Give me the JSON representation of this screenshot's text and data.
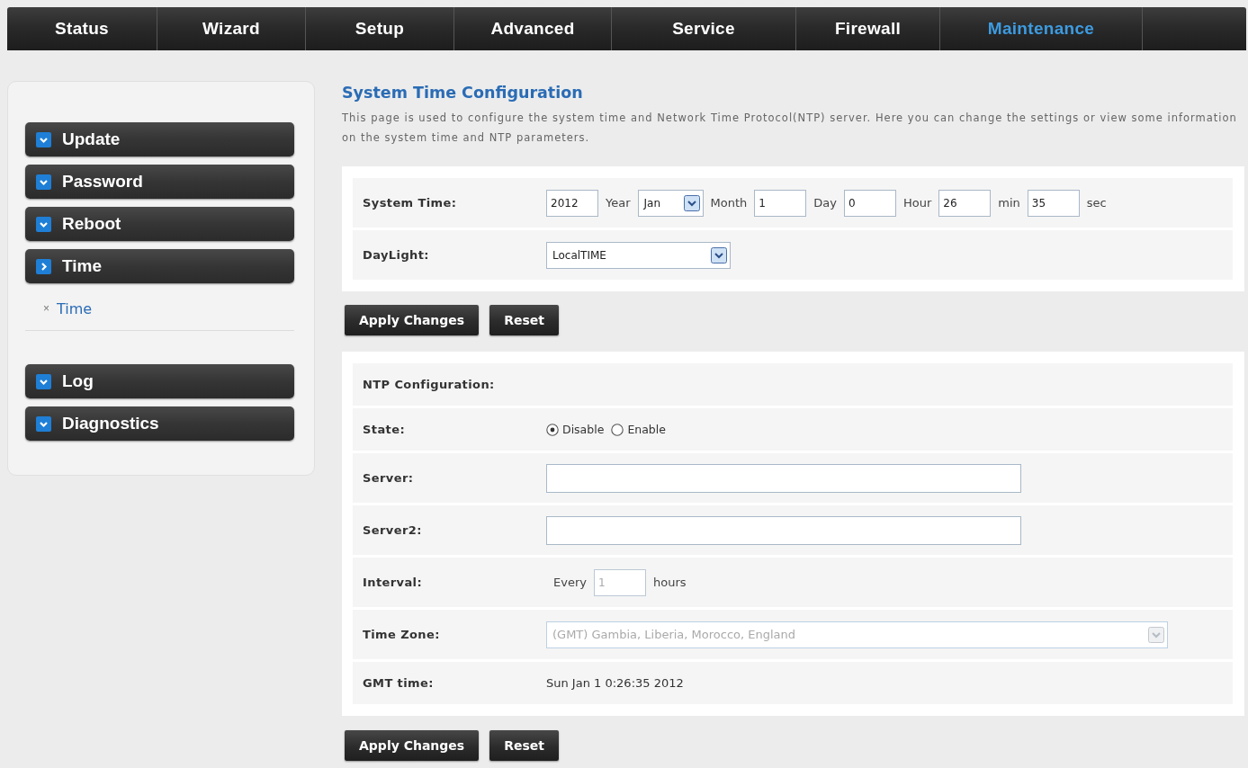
{
  "nav": {
    "tabs": [
      {
        "label": "Status",
        "selected": false
      },
      {
        "label": "Wizard",
        "selected": false
      },
      {
        "label": "Setup",
        "selected": false
      },
      {
        "label": "Advanced",
        "selected": false
      },
      {
        "label": "Service",
        "selected": false
      },
      {
        "label": "Firewall",
        "selected": false
      },
      {
        "label": "Maintenance",
        "selected": true
      }
    ]
  },
  "sidebar": {
    "sections": [
      {
        "items": [
          {
            "label": "Update",
            "expanded": false
          },
          {
            "label": "Password",
            "expanded": false
          },
          {
            "label": "Reboot",
            "expanded": false
          },
          {
            "label": "Time",
            "expanded": true,
            "children": [
              {
                "marker": "×",
                "label": "Time"
              }
            ]
          }
        ]
      },
      {
        "items": [
          {
            "label": "Log",
            "expanded": false
          },
          {
            "label": "Diagnostics",
            "expanded": false
          }
        ]
      }
    ]
  },
  "page": {
    "title": "System Time Configuration",
    "description": "This page is used to configure the system time and Network Time Protocol(NTP) server. Here you can change the settings or view some information on the system time and NTP parameters."
  },
  "forms": [
    {
      "rows": [
        {
          "kind": "inline",
          "label": "System Time:",
          "parts": [
            {
              "kind": "input",
              "value": "2012",
              "disabled": false
            },
            {
              "kind": "text",
              "text": "Year"
            },
            {
              "kind": "select",
              "value": "Jan",
              "disabled": false
            },
            {
              "kind": "text",
              "text": "Month"
            },
            {
              "kind": "input",
              "value": "1",
              "disabled": false
            },
            {
              "kind": "text",
              "text": "Day"
            },
            {
              "kind": "input",
              "value": "0",
              "disabled": false
            },
            {
              "kind": "text",
              "text": "Hour"
            },
            {
              "kind": "input",
              "value": "26",
              "disabled": false
            },
            {
              "kind": "text",
              "text": "min"
            },
            {
              "kind": "input",
              "value": "35",
              "disabled": false
            },
            {
              "kind": "text",
              "text": "sec"
            }
          ]
        },
        {
          "kind": "select",
          "label": "DayLight:",
          "value": "LocalTIME",
          "disabled": false
        }
      ],
      "buttons": [
        "Apply Changes",
        "Reset"
      ]
    },
    {
      "rows": [
        {
          "kind": "heading",
          "label": "NTP Configuration:"
        },
        {
          "kind": "radios",
          "label": "State:",
          "options": [
            {
              "label": "Disable",
              "selected": true
            },
            {
              "label": "Enable",
              "selected": false
            }
          ]
        },
        {
          "kind": "input",
          "label": "Server:",
          "disabled": false
        },
        {
          "kind": "input",
          "label": "Server2:",
          "disabled": false
        },
        {
          "kind": "inline",
          "label": "Interval:",
          "parts": [
            {
              "kind": "text",
              "text": "Every"
            },
            {
              "kind": "input",
              "value": "1",
              "disabled": true
            },
            {
              "kind": "text",
              "text": "hours"
            }
          ]
        },
        {
          "kind": "wide-select",
          "label": "Time Zone:",
          "value": "(GMT) Gambia, Liberia, Morocco, England",
          "disabled": true
        },
        {
          "kind": "readout",
          "label": "GMT time:",
          "text": "Sun Jan 1 0:26:35 2012"
        }
      ],
      "buttons": [
        "Apply Changes",
        "Reset"
      ]
    }
  ]
}
